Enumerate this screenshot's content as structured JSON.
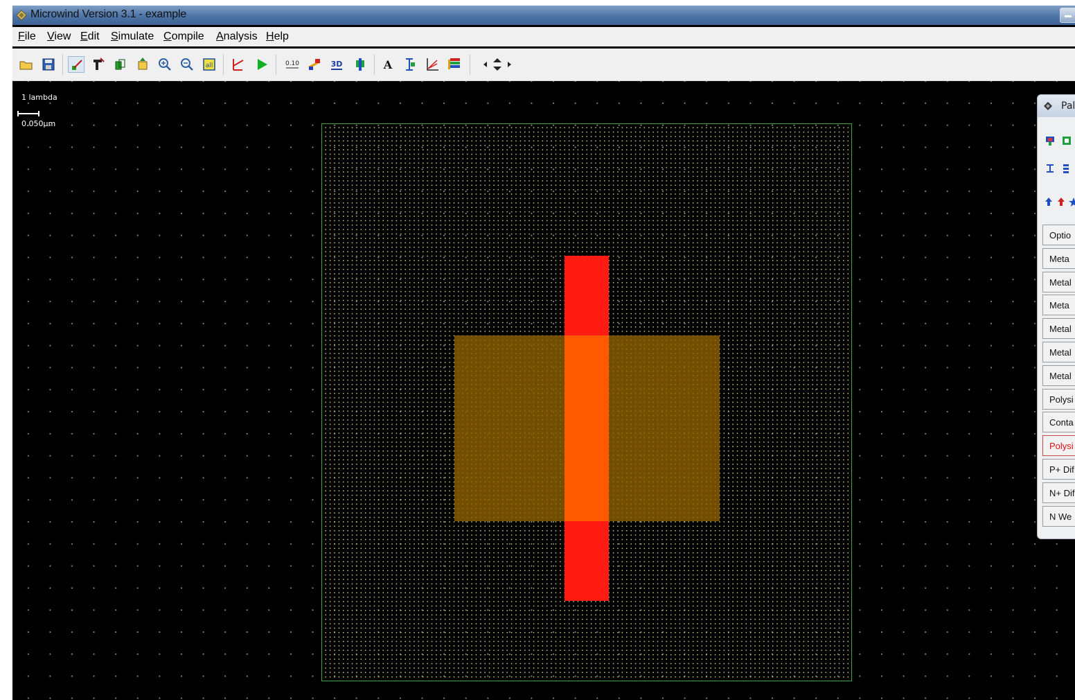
{
  "window": {
    "title": "Microwind Version 3.1 - example",
    "icons": {
      "app": "microwind-app-icon",
      "minimize": "minimize-icon"
    }
  },
  "menu": [
    {
      "label": "File",
      "mnemonic": "F",
      "rest": "ile"
    },
    {
      "label": "View",
      "mnemonic": "V",
      "rest": "iew"
    },
    {
      "label": "Edit",
      "mnemonic": "E",
      "rest": "dit"
    },
    {
      "label": "Simulate",
      "mnemonic": "S",
      "rest": "imulate"
    },
    {
      "label": "Compile",
      "mnemonic": "C",
      "rest": "ompile"
    },
    {
      "label": "Analysis",
      "mnemonic": "A",
      "rest": "nalysis"
    },
    {
      "label": "Help",
      "mnemonic": "H",
      "rest": "elp"
    }
  ],
  "toolbar": {
    "zoom_label": "0.10",
    "view3d_label": "3D",
    "text_label": "A",
    "icons": [
      "open-folder-icon",
      "save-icon",
      "draw-box-icon",
      "edit-layout-icon",
      "duplicate-icon",
      "move-icon",
      "zoom-in-icon",
      "zoom-out-icon",
      "view-all-icon",
      "design-rules-icon",
      "simulate-run-icon",
      "cross-section-icon",
      "connect-icon",
      "view-3d-icon",
      "measure-icon",
      "add-text-icon",
      "add-node-icon",
      "plot-icon",
      "layer-colors-icon",
      "navigate-arrows-icon"
    ]
  },
  "canvas": {
    "scale_label": "1 lambda",
    "scale_value": "0.050µm",
    "colors": {
      "background": "#000000",
      "cell_boundary": "#3aa63a",
      "polysilicon": "#ff1a12",
      "diffusion": "#8c5f00",
      "gate_overlap": "#ff5a00"
    }
  },
  "palette": {
    "title": "Pal",
    "layers": [
      {
        "label": "Optio"
      },
      {
        "label": "Meta"
      },
      {
        "label": "Metal"
      },
      {
        "label": "Meta"
      },
      {
        "label": "Metal"
      },
      {
        "label": "Metal"
      },
      {
        "label": "Metal"
      },
      {
        "label": "Polysi"
      },
      {
        "label": "Conta"
      },
      {
        "label": "Polysi",
        "active": true
      },
      {
        "label": "P+ Dif"
      },
      {
        "label": "N+ Dif"
      },
      {
        "label": "N We"
      }
    ]
  }
}
